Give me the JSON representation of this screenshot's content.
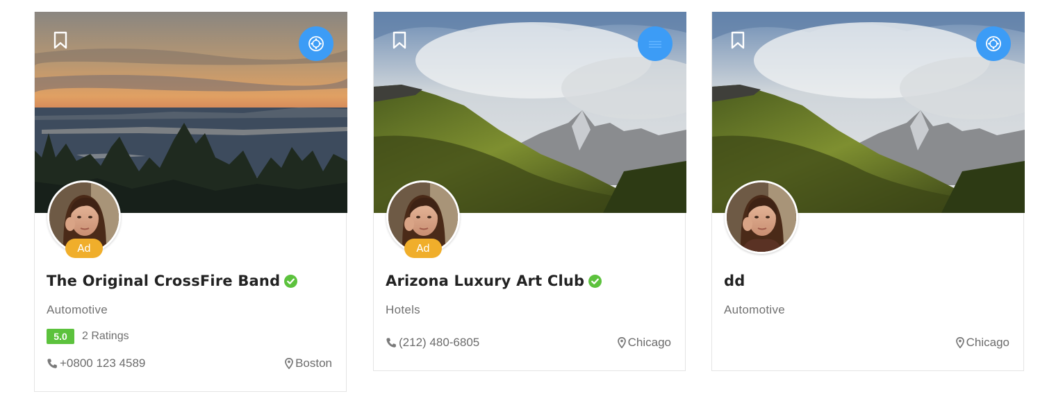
{
  "colors": {
    "accent_blue": "#3c9cf6",
    "ad_badge": "#f0ae2b",
    "rating_green": "#5cc23d",
    "verified_green": "#5cc23d"
  },
  "listings": [
    {
      "title": "The Original CrossFire Band",
      "verified": true,
      "ad_label": "Ad",
      "category": "Automotive",
      "rating": "5.0",
      "rating_count": "2 Ratings",
      "phone": "+0800 123 4589",
      "location": "Boston",
      "category_icon": "category-circle-icon"
    },
    {
      "title": "Arizona Luxury Art Club",
      "verified": true,
      "ad_label": "Ad",
      "category": "Hotels",
      "phone": "(212) 480-6805",
      "location": "Chicago",
      "category_icon": "bed-icon"
    },
    {
      "title": "dd",
      "verified": false,
      "category": "Automotive",
      "location": "Chicago",
      "category_icon": "category-circle-icon"
    }
  ]
}
